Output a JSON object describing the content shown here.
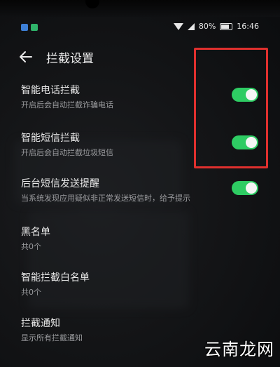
{
  "status_bar": {
    "battery": "80%",
    "battery_level": 0.8,
    "time": "16:46",
    "icons": [
      "gallery-notification-icon",
      "app-notification-icon",
      "wifi-icon",
      "signal-icon",
      "battery-icon"
    ]
  },
  "header": {
    "back_icon": "arrow-left-icon",
    "title": "拦截设置"
  },
  "settings": [
    {
      "title": "智能电话拦截",
      "subtitle": "开启后会自动拦截诈骗电话",
      "toggle_on": true
    },
    {
      "title": "智能短信拦截",
      "subtitle": "开启后会自动拦截垃圾短信",
      "toggle_on": true
    },
    {
      "title": "后台短信发送提醒",
      "subtitle": "当系统发现应用疑似非正常发送短信时，给予提示",
      "toggle_on": true
    },
    {
      "title": "黑名单",
      "subtitle": "共0个"
    },
    {
      "title": "智能拦截白名单",
      "subtitle": "共0个"
    },
    {
      "title": "拦截通知",
      "subtitle": "显示所有拦截通知"
    }
  ],
  "annotation": {
    "color": "#e0302e"
  },
  "colors": {
    "toggle_on": "#2ecc63",
    "background": "#141517"
  },
  "watermark": "云南龙网"
}
